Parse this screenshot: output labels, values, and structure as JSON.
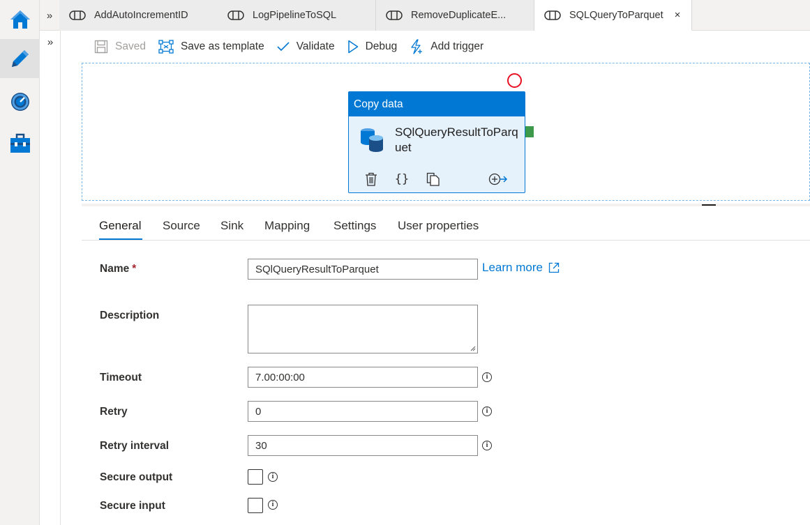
{
  "tabs": [
    {
      "label": "AddAutoIncrementID",
      "active": false
    },
    {
      "label": "LogPipelineToSQL",
      "active": false
    },
    {
      "label": "RemoveDuplicateE...",
      "active": false
    },
    {
      "label": "SQLQueryToParquet",
      "active": true
    }
  ],
  "tab_expand_glyph": "»",
  "subrail_expand_glyph": "»",
  "tab_close_glyph": "×",
  "toolbar": {
    "saved": "Saved",
    "save_as_template": "Save as template",
    "validate": "Validate",
    "debug": "Debug",
    "add_trigger": "Add trigger"
  },
  "activity": {
    "type_label": "Copy data",
    "name": "SQlQueryResultToParquet",
    "json_glyph": "{}"
  },
  "properties_tabs": [
    "General",
    "Source",
    "Sink",
    "Mapping",
    "Settings",
    "User properties"
  ],
  "form": {
    "name_label": "Name",
    "required_marker": "*",
    "name_value": "SQlQueryResultToParquet",
    "learn_more": "Learn more",
    "description_label": "Description",
    "description_value": "",
    "timeout_label": "Timeout",
    "timeout_value": "7.00:00:00",
    "retry_label": "Retry",
    "retry_value": "0",
    "retry_interval_label": "Retry interval",
    "retry_interval_value": "30",
    "secure_output_label": "Secure output",
    "secure_input_label": "Secure input",
    "info_glyph": "i"
  },
  "colors": {
    "accent": "#0078d4",
    "activity_bg": "#e5f1fb",
    "error_circle": "#e81123",
    "success_handle": "#3e9a4b",
    "required": "#a4262c"
  },
  "icons": {
    "rail": [
      "home-icon",
      "author-pencil-icon",
      "monitor-gauge-icon",
      "manage-toolbox-icon"
    ],
    "pipeline_tab": "pipeline-icon",
    "activity": "database-icon"
  }
}
